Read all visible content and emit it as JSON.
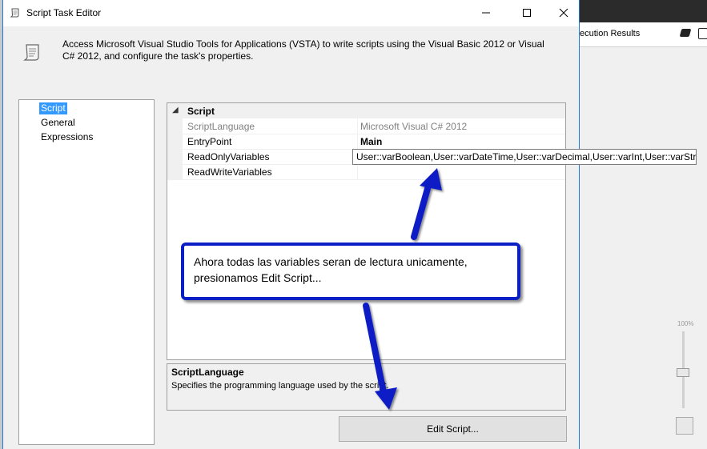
{
  "background_app": {
    "tab_label": "ecution Results",
    "zoom_label": "100%"
  },
  "dialog": {
    "title": "Script Task Editor",
    "description": "Access Microsoft Visual Studio Tools for Applications (VSTA) to write scripts using the Visual Basic 2012 or Visual C# 2012, and configure the task's properties.",
    "nav_items": [
      {
        "label": "Script",
        "selected": true
      },
      {
        "label": "General",
        "selected": false
      },
      {
        "label": "Expressions",
        "selected": false
      }
    ],
    "property_grid": {
      "category": "Script",
      "rows": [
        {
          "name": "ScriptLanguage",
          "value": "Microsoft Visual C# 2012"
        },
        {
          "name": "EntryPoint",
          "value": "Main"
        },
        {
          "name": "ReadOnlyVariables",
          "value": "User::varBoolean,User::varDateTime,User::varDecimal,User::varInt,User::varString"
        },
        {
          "name": "ReadWriteVariables",
          "value": ""
        }
      ]
    },
    "description_panel": {
      "title": "ScriptLanguage",
      "text": "Specifies the programming language used by the script."
    },
    "edit_button_label": "Edit Script..."
  },
  "annotation": {
    "text": "Ahora todas las variables seran de lectura unicamente, presionamos Edit Script...",
    "color": "#0b1fc4"
  },
  "colors": {
    "selection": "#3399ff",
    "window_border": "#1e7ad0"
  }
}
